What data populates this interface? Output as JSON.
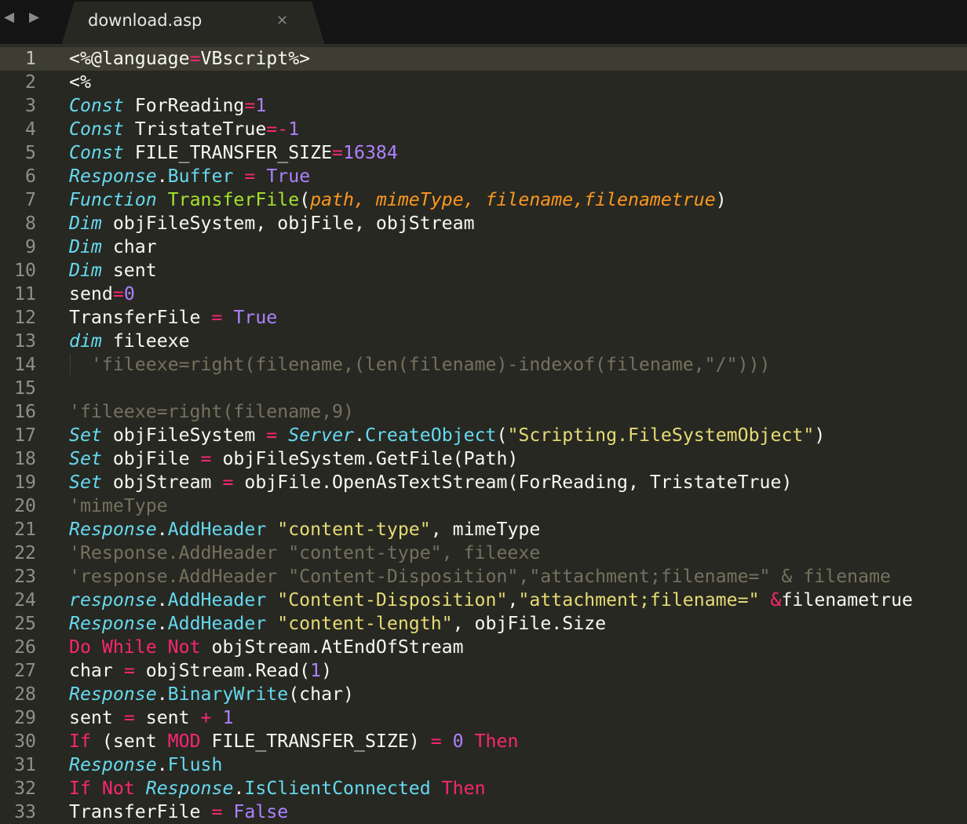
{
  "tabbar": {
    "nav_left": "◀",
    "nav_right": "▶",
    "active_tab": {
      "title": "download.asp",
      "close": "×"
    }
  },
  "editor": {
    "current_line": 1,
    "lines": [
      {
        "n": "1",
        "tokens": [
          [
            "plain",
            "<%@language"
          ],
          [
            "op",
            "="
          ],
          [
            "plain",
            "VBscript%>"
          ]
        ]
      },
      {
        "n": "2",
        "tokens": [
          [
            "plain",
            "<%"
          ]
        ]
      },
      {
        "n": "3",
        "tokens": [
          [
            "kw",
            "Const"
          ],
          [
            "plain",
            " ForReading"
          ],
          [
            "op",
            "="
          ],
          [
            "num",
            "1"
          ]
        ]
      },
      {
        "n": "4",
        "tokens": [
          [
            "kw",
            "Const"
          ],
          [
            "plain",
            " TristateTrue"
          ],
          [
            "op",
            "=-"
          ],
          [
            "num",
            "1"
          ]
        ]
      },
      {
        "n": "5",
        "tokens": [
          [
            "kw",
            "Const"
          ],
          [
            "plain",
            " FILE_TRANSFER_SIZE"
          ],
          [
            "op",
            "="
          ],
          [
            "num",
            "16384"
          ]
        ]
      },
      {
        "n": "6",
        "tokens": [
          [
            "kw",
            "Response"
          ],
          [
            "plain",
            "."
          ],
          [
            "mth",
            "Buffer"
          ],
          [
            "plain",
            " "
          ],
          [
            "op",
            "="
          ],
          [
            "plain",
            " "
          ],
          [
            "num",
            "True"
          ]
        ]
      },
      {
        "n": "7",
        "tokens": [
          [
            "kw",
            "Function"
          ],
          [
            "plain",
            " "
          ],
          [
            "fn",
            "TransferFile"
          ],
          [
            "plain",
            "("
          ],
          [
            "prm",
            "path, mimeType, filename,filenametrue"
          ],
          [
            "plain",
            ")"
          ]
        ]
      },
      {
        "n": "8",
        "tokens": [
          [
            "kw",
            "Dim"
          ],
          [
            "plain",
            " objFileSystem, objFile, objStream"
          ]
        ]
      },
      {
        "n": "9",
        "tokens": [
          [
            "kw",
            "Dim"
          ],
          [
            "plain",
            " char"
          ]
        ]
      },
      {
        "n": "10",
        "tokens": [
          [
            "kw",
            "Dim"
          ],
          [
            "plain",
            " sent"
          ]
        ]
      },
      {
        "n": "11",
        "tokens": [
          [
            "plain",
            "send"
          ],
          [
            "op",
            "="
          ],
          [
            "num",
            "0"
          ]
        ]
      },
      {
        "n": "12",
        "tokens": [
          [
            "plain",
            "TransferFile "
          ],
          [
            "op",
            "="
          ],
          [
            "plain",
            " "
          ],
          [
            "num",
            "True"
          ]
        ]
      },
      {
        "n": "13",
        "tokens": [
          [
            "kw",
            "dim"
          ],
          [
            "plain",
            " fileexe"
          ]
        ]
      },
      {
        "n": "14",
        "guide": true,
        "tokens": [
          [
            "plain",
            "  "
          ],
          [
            "cmt",
            "'fileexe=right(filename,(len(filename)-indexof(filename,\"/\")))"
          ]
        ]
      },
      {
        "n": "15",
        "tokens": []
      },
      {
        "n": "16",
        "tokens": [
          [
            "cmt",
            "'fileexe=right(filename,9)"
          ]
        ]
      },
      {
        "n": "17",
        "tokens": [
          [
            "kw",
            "Set"
          ],
          [
            "plain",
            " objFileSystem "
          ],
          [
            "op",
            "="
          ],
          [
            "plain",
            " "
          ],
          [
            "kw",
            "Server"
          ],
          [
            "plain",
            "."
          ],
          [
            "mth",
            "CreateObject"
          ],
          [
            "plain",
            "("
          ],
          [
            "str",
            "\"Scripting.FileSystemObject\""
          ],
          [
            "plain",
            ")"
          ]
        ]
      },
      {
        "n": "18",
        "tokens": [
          [
            "kw",
            "Set"
          ],
          [
            "plain",
            " objFile "
          ],
          [
            "op",
            "="
          ],
          [
            "plain",
            " objFileSystem.GetFile(Path)"
          ]
        ]
      },
      {
        "n": "19",
        "tokens": [
          [
            "kw",
            "Set"
          ],
          [
            "plain",
            " objStream "
          ],
          [
            "op",
            "="
          ],
          [
            "plain",
            " objFile.OpenAsTextStream(ForReading, TristateTrue)"
          ]
        ]
      },
      {
        "n": "20",
        "tokens": [
          [
            "cmt",
            "'mimeType"
          ]
        ]
      },
      {
        "n": "21",
        "tokens": [
          [
            "kw",
            "Response"
          ],
          [
            "plain",
            "."
          ],
          [
            "mth",
            "AddHeader"
          ],
          [
            "plain",
            " "
          ],
          [
            "str",
            "\"content-type\""
          ],
          [
            "plain",
            ", mimeType"
          ]
        ]
      },
      {
        "n": "22",
        "tokens": [
          [
            "cmt",
            "'Response.AddHeader \"content-type\", fileexe"
          ]
        ]
      },
      {
        "n": "23",
        "tokens": [
          [
            "cmt",
            "'response.AddHeader \"Content-Disposition\",\"attachment;filename=\" & filename"
          ]
        ]
      },
      {
        "n": "24",
        "tokens": [
          [
            "kw",
            "response"
          ],
          [
            "plain",
            "."
          ],
          [
            "mth",
            "AddHeader"
          ],
          [
            "plain",
            " "
          ],
          [
            "str",
            "\"Content-Disposition\""
          ],
          [
            "plain",
            ","
          ],
          [
            "str",
            "\"attachment;filename=\""
          ],
          [
            "plain",
            " "
          ],
          [
            "op",
            "&"
          ],
          [
            "plain",
            "filenametrue"
          ]
        ]
      },
      {
        "n": "25",
        "tokens": [
          [
            "kw",
            "Response"
          ],
          [
            "plain",
            "."
          ],
          [
            "mth",
            "AddHeader"
          ],
          [
            "plain",
            " "
          ],
          [
            "str",
            "\"content-length\""
          ],
          [
            "plain",
            ", objFile.Size"
          ]
        ]
      },
      {
        "n": "26",
        "tokens": [
          [
            "ctl",
            "Do"
          ],
          [
            "plain",
            " "
          ],
          [
            "ctl",
            "While"
          ],
          [
            "plain",
            " "
          ],
          [
            "ctl",
            "Not"
          ],
          [
            "plain",
            " objStream.AtEndOfStream"
          ]
        ]
      },
      {
        "n": "27",
        "tokens": [
          [
            "plain",
            "char "
          ],
          [
            "op",
            "="
          ],
          [
            "plain",
            " objStream.Read("
          ],
          [
            "num",
            "1"
          ],
          [
            "plain",
            ")"
          ]
        ]
      },
      {
        "n": "28",
        "tokens": [
          [
            "kw",
            "Response"
          ],
          [
            "plain",
            "."
          ],
          [
            "mth",
            "BinaryWrite"
          ],
          [
            "plain",
            "(char)"
          ]
        ]
      },
      {
        "n": "29",
        "tokens": [
          [
            "plain",
            "sent "
          ],
          [
            "op",
            "="
          ],
          [
            "plain",
            " sent "
          ],
          [
            "op",
            "+"
          ],
          [
            "plain",
            " "
          ],
          [
            "num",
            "1"
          ]
        ]
      },
      {
        "n": "30",
        "tokens": [
          [
            "ctl",
            "If"
          ],
          [
            "plain",
            " (sent "
          ],
          [
            "ctl",
            "MOD"
          ],
          [
            "plain",
            " FILE_TRANSFER_SIZE) "
          ],
          [
            "op",
            "="
          ],
          [
            "plain",
            " "
          ],
          [
            "num",
            "0"
          ],
          [
            "plain",
            " "
          ],
          [
            "ctl",
            "Then"
          ]
        ]
      },
      {
        "n": "31",
        "tokens": [
          [
            "kw",
            "Response"
          ],
          [
            "plain",
            "."
          ],
          [
            "mth",
            "Flush"
          ]
        ]
      },
      {
        "n": "32",
        "tokens": [
          [
            "ctl",
            "If"
          ],
          [
            "plain",
            " "
          ],
          [
            "ctl",
            "Not"
          ],
          [
            "plain",
            " "
          ],
          [
            "kw",
            "Response"
          ],
          [
            "plain",
            "."
          ],
          [
            "mth",
            "IsClientConnected"
          ],
          [
            "plain",
            " "
          ],
          [
            "ctl",
            "Then"
          ]
        ]
      },
      {
        "n": "33",
        "tokens": [
          [
            "plain",
            "TransferFile "
          ],
          [
            "op",
            "="
          ],
          [
            "plain",
            " "
          ],
          [
            "num",
            "False"
          ]
        ]
      }
    ]
  }
}
